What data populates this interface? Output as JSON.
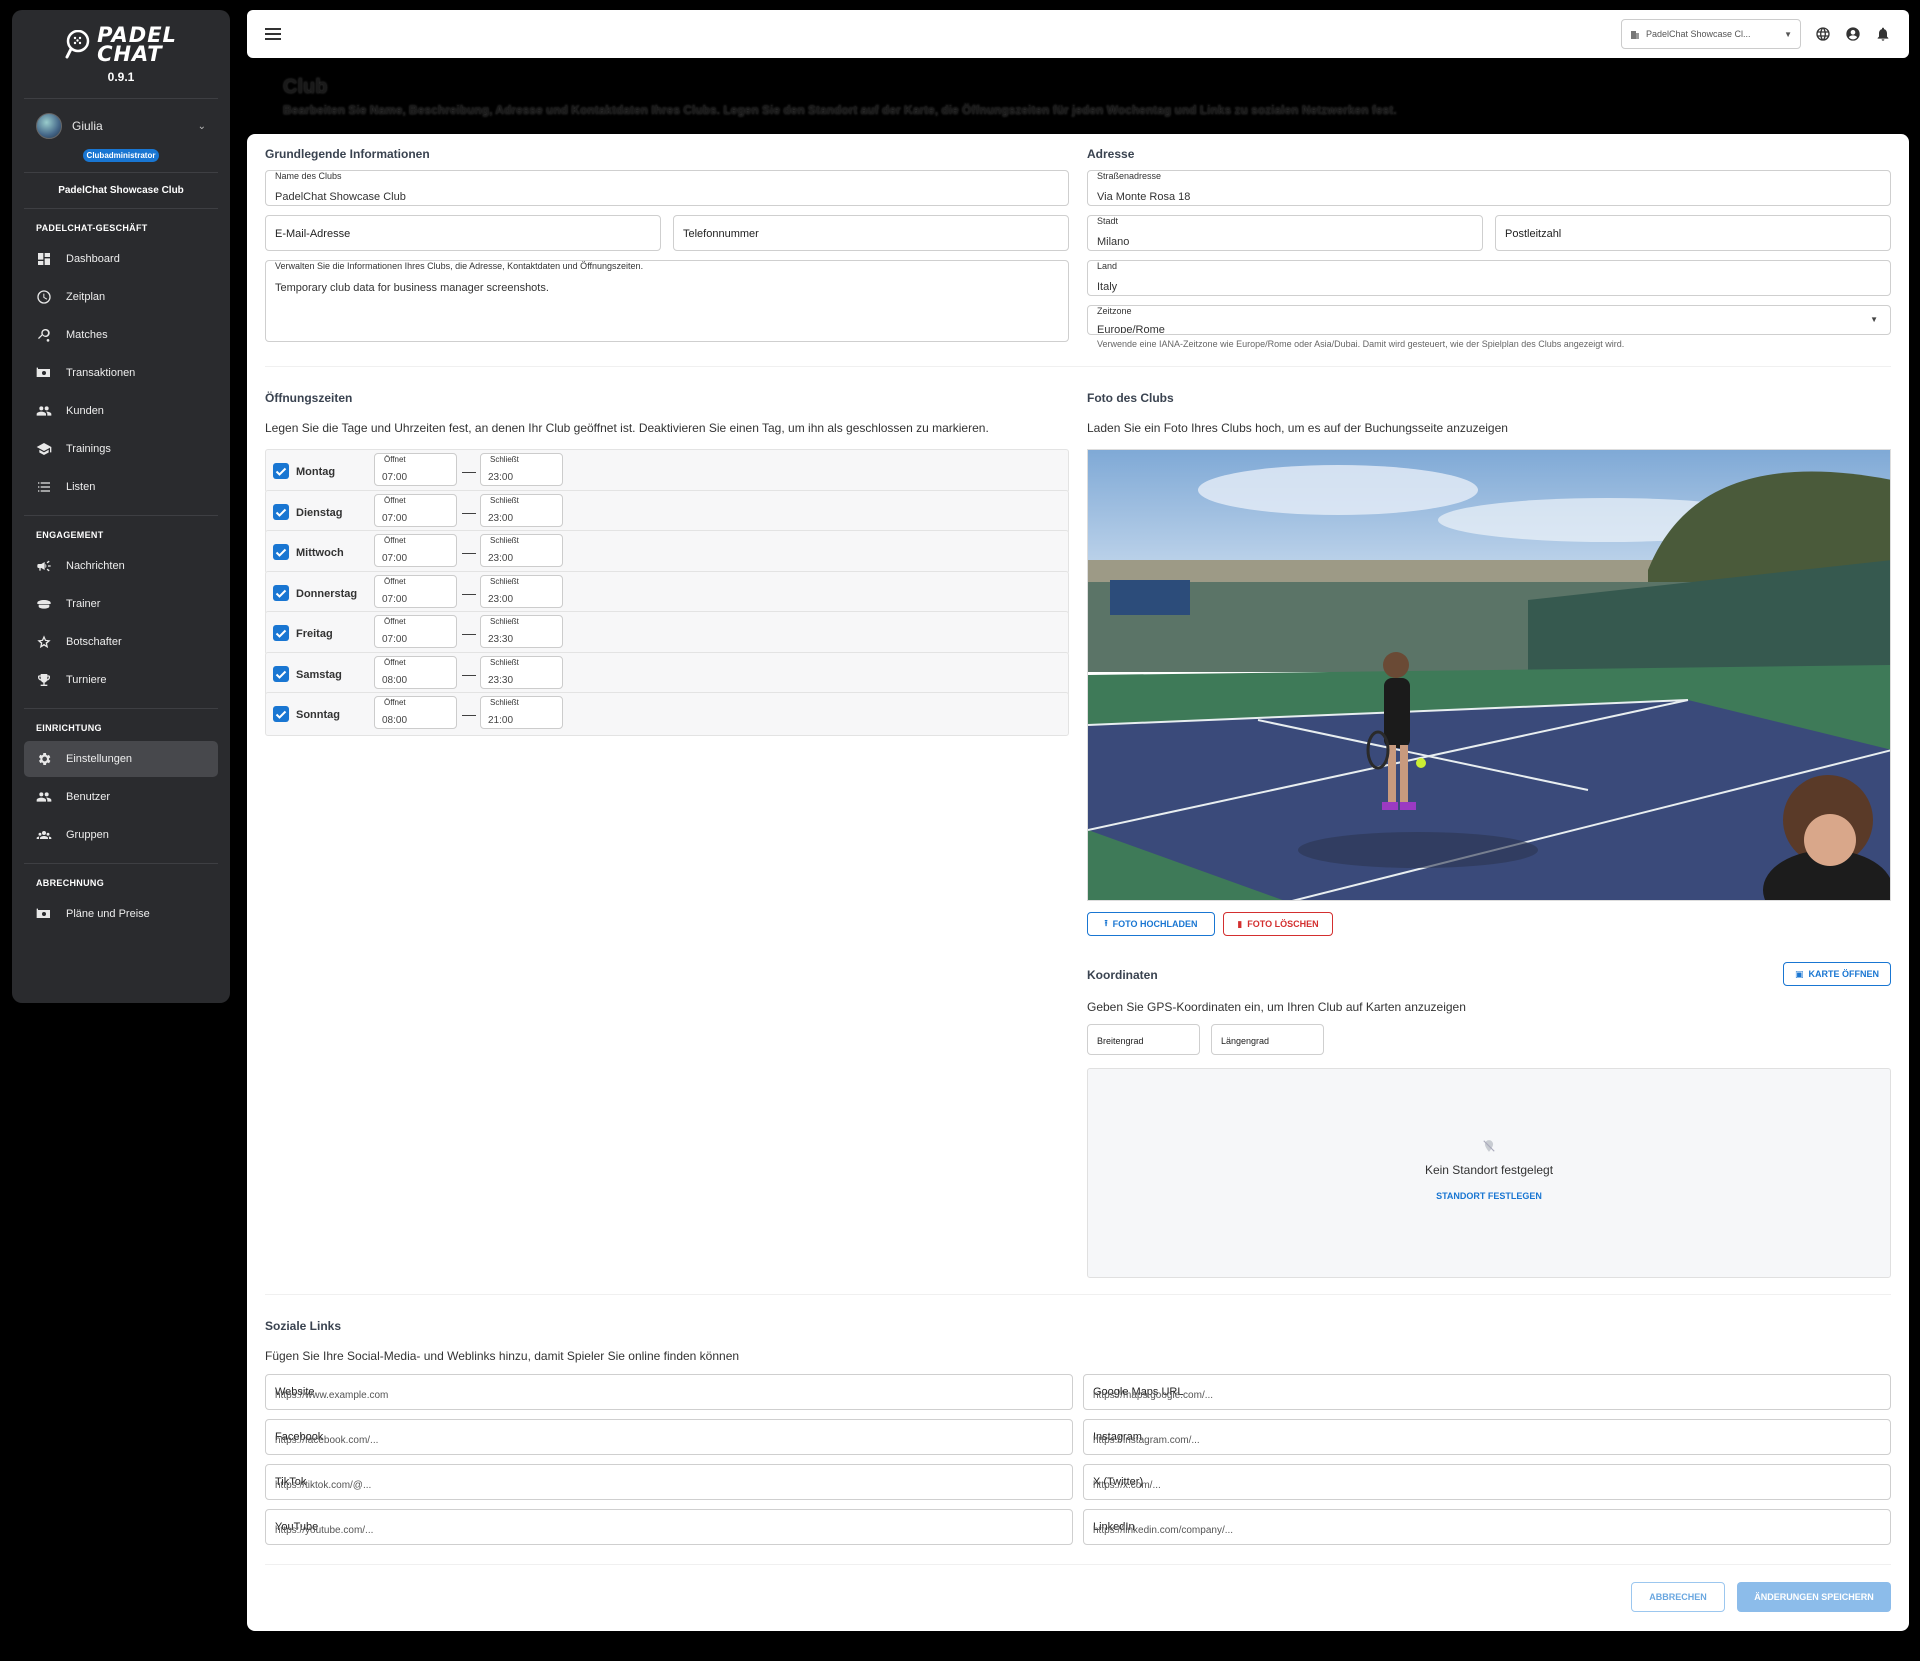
{
  "app": {
    "logo_line1": "PADEL",
    "logo_line2": "CHAT",
    "version": "0.9.1"
  },
  "user": {
    "name": "Giulia",
    "role": "Clubadministrator",
    "club": "PadelChat Showcase Club"
  },
  "sidebar": {
    "sections": [
      {
        "title": "PADELCHAT-GESCHÄFT",
        "items": [
          "Dashboard",
          "Zeitplan",
          "Matches",
          "Transaktionen",
          "Kunden",
          "Trainings",
          "Listen"
        ]
      },
      {
        "title": "ENGAGEMENT",
        "items": [
          "Nachrichten",
          "Trainer",
          "Botschafter",
          "Turniere"
        ]
      },
      {
        "title": "EINRICHTUNG",
        "items": [
          "Einstellungen",
          "Benutzer",
          "Gruppen"
        ]
      },
      {
        "title": "ABRECHNUNG",
        "items": [
          "Pläne und Preise"
        ]
      }
    ],
    "active": "Einstellungen"
  },
  "topbar": {
    "club_select": "PadelChat Showcase Cl..."
  },
  "page": {
    "title": "Club",
    "subtitle": "Bearbeiten Sie Name, Beschreibung, Adresse und Kontaktdaten Ihres Clubs. Legen Sie den Standort auf der Karte, die Öffnungszeiten für jeden Wochentag und Links zu sozialen Netzwerken fest."
  },
  "basic": {
    "title": "Grundlegende Informationen",
    "name_label": "Name des Clubs",
    "name_value": "PadelChat Showcase Club",
    "email_placeholder": "E-Mail-Adresse",
    "phone_placeholder": "Telefonnummer",
    "desc_label": "Verwalten Sie die Informationen Ihres Clubs, die Adresse, Kontaktdaten und Öffnungszeiten.",
    "desc_value": "Temporary club data for business manager screenshots."
  },
  "address": {
    "title": "Adresse",
    "street_label": "Straßenadresse",
    "street_value": "Via Monte Rosa 18",
    "city_label": "Stadt",
    "city_value": "Milano",
    "zip_placeholder": "Postleitzahl",
    "country_label": "Land",
    "country_value": "Italy",
    "tz_label": "Zeitzone",
    "tz_value": "Europe/Rome",
    "tz_hint": "Verwende eine IANA-Zeitzone wie Europe/Rome oder Asia/Dubai. Damit wird gesteuert, wie der Spielplan des Clubs angezeigt wird."
  },
  "hours": {
    "title": "Öffnungszeiten",
    "description": "Legen Sie die Tage und Uhrzeiten fest, an denen Ihr Club geöffnet ist. Deaktivieren Sie einen Tag, um ihn als geschlossen zu markieren.",
    "open_label": "Öffnet",
    "close_label": "Schließt",
    "dash": "—",
    "days": [
      {
        "name": "Montag",
        "open": "07:00",
        "close": "23:00",
        "enabled": true
      },
      {
        "name": "Dienstag",
        "open": "07:00",
        "close": "23:00",
        "enabled": true
      },
      {
        "name": "Mittwoch",
        "open": "07:00",
        "close": "23:00",
        "enabled": true
      },
      {
        "name": "Donnerstag",
        "open": "07:00",
        "close": "23:00",
        "enabled": true
      },
      {
        "name": "Freitag",
        "open": "07:00",
        "close": "23:30",
        "enabled": true
      },
      {
        "name": "Samstag",
        "open": "08:00",
        "close": "23:30",
        "enabled": true
      },
      {
        "name": "Sonntag",
        "open": "08:00",
        "close": "21:00",
        "enabled": true
      }
    ]
  },
  "photo": {
    "title": "Foto des Clubs",
    "description": "Laden Sie ein Foto Ihres Clubs hoch, um es auf der Buchungsseite anzuzeigen",
    "upload_label": "FOTO HOCHLADEN",
    "delete_label": "FOTO LÖSCHEN"
  },
  "coords": {
    "title": "Koordinaten",
    "open_map_label": "KARTE ÖFFNEN",
    "description": "Geben Sie GPS-Koordinaten ein, um Ihren Club auf Karten anzuzeigen",
    "lat_placeholder": "Breitengrad",
    "lng_placeholder": "Längengrad",
    "no_location": "Kein Standort festgelegt",
    "set_location": "STANDORT FESTLEGEN"
  },
  "social": {
    "title": "Soziale Links",
    "description": "Fügen Sie Ihre Social-Media- und Weblinks hinzu, damit Spieler Sie online finden können",
    "fields": [
      {
        "label": "Website",
        "placeholder": "https://www.example.com"
      },
      {
        "label": "Google Maps URL",
        "placeholder": "https://maps.google.com/..."
      },
      {
        "label": "Facebook",
        "placeholder": "https://facebook.com/..."
      },
      {
        "label": "Instagram",
        "placeholder": "https://instagram.com/..."
      },
      {
        "label": "TikTok",
        "placeholder": "https://tiktok.com/@..."
      },
      {
        "label": "X (Twitter)",
        "placeholder": "https://x.com/..."
      },
      {
        "label": "YouTube",
        "placeholder": "https://youtube.com/..."
      },
      {
        "label": "LinkedIn",
        "placeholder": "https://linkedin.com/company/..."
      }
    ]
  },
  "actions": {
    "cancel": "ABBRECHEN",
    "save": "ÄNDERUNGEN SPEICHERN"
  },
  "colors": {
    "primary": "#1976d2",
    "danger": "#d32f2f",
    "sidebar_bg": "#2a2b2e"
  }
}
